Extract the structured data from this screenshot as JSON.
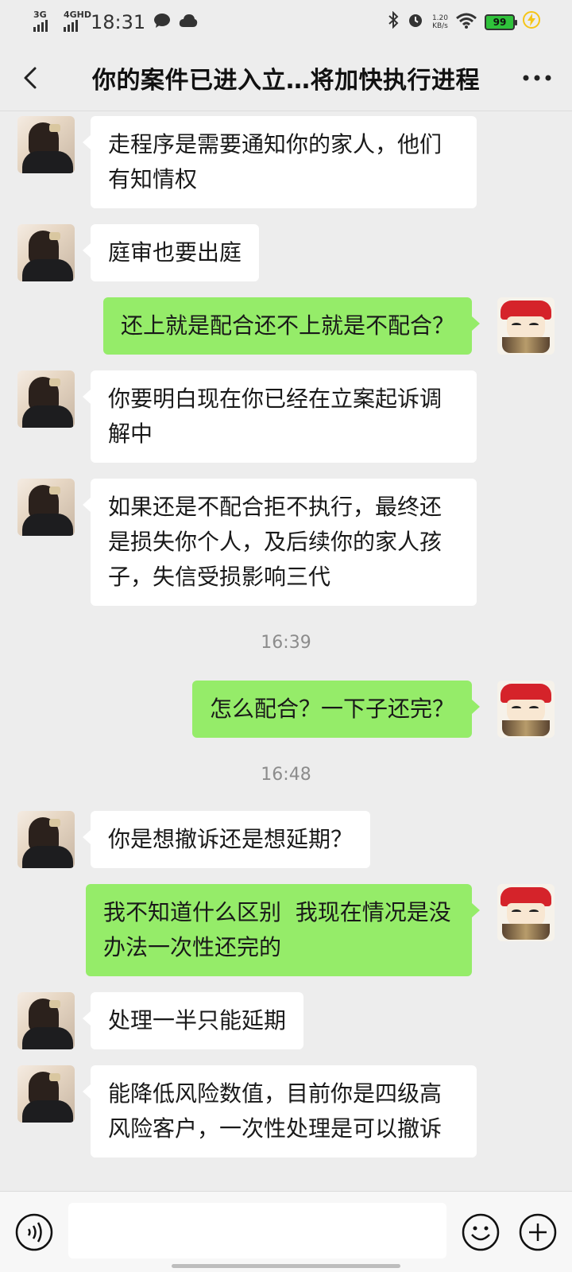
{
  "status_bar": {
    "net1": "3G",
    "net2": "4GHD",
    "time": "18:31",
    "speed_value": "1.20",
    "speed_unit": "KB/s",
    "battery": "99"
  },
  "header": {
    "title": "你的案件已进入立…将加快执行进程"
  },
  "messages": [
    {
      "side": "left",
      "text": "走程序是需要通知你的家人，他们有知情权"
    },
    {
      "side": "left",
      "text": "庭审也要出庭"
    },
    {
      "side": "right",
      "text": "还上就是配合还不上就是不配合？"
    },
    {
      "side": "left",
      "text": "你要明白现在你已经在立案起诉调解中"
    },
    {
      "side": "left",
      "text": "如果还是不配合拒不执行，最终还是损失你个人，及后续你的家人孩子，失信受损影响三代"
    },
    {
      "side": "time",
      "text": "16:39"
    },
    {
      "side": "right",
      "text": "怎么配合？一下子还完？"
    },
    {
      "side": "time",
      "text": "16:48"
    },
    {
      "side": "left",
      "text": "你是想撤诉还是想延期？"
    },
    {
      "side": "right",
      "text": "我不知道什么区别  我现在情况是没办法一次性还完的"
    },
    {
      "side": "left",
      "text": "处理一半只能延期"
    },
    {
      "side": "left",
      "text": "能降低风险数值，目前你是四级高风险客户，一次性处理是可以撤诉"
    }
  ],
  "input": {
    "value": ""
  },
  "colors": {
    "background": "#ededed",
    "bubble_self": "#95ec69",
    "bubble_other": "#ffffff"
  }
}
